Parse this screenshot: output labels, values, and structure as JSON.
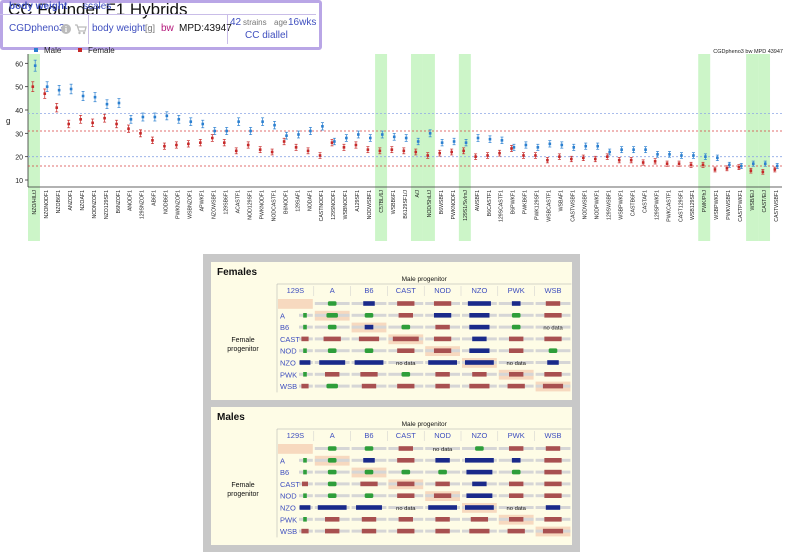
{
  "page_title": "CC Founder F1 Hybrids",
  "info": {
    "measure_label": "body weight",
    "scales_label": "scales",
    "dataset": "CGDpheno3",
    "info_icon": "info-icon",
    "cart_icon": "cart-icon",
    "measure_name": "body weight",
    "units": "[g]",
    "abbrev": "bw",
    "mpd_id": "MPD:43947",
    "strains_count": "42",
    "strains_label": "strains",
    "age_label": "age",
    "age_value": "16wks",
    "panel_name": "CC diallel"
  },
  "chart_data": {
    "type": "scatter",
    "title": "",
    "corner_label": "CGDpheno3 bw MPD 43947",
    "ylabel": "g",
    "ylim": [
      7,
      64
    ],
    "yticks": [
      10,
      20,
      30,
      40,
      50,
      60
    ],
    "legend": [
      {
        "name": "Male",
        "color": "#2a7fd0"
      },
      {
        "name": "Female",
        "color": "#c62828"
      }
    ],
    "legend_position": "top-left",
    "ref_lines": {
      "male": [
        38.5,
        20
      ],
      "female": [
        31,
        16
      ]
    },
    "highlighted": [
      "NZO/HILtJ",
      "C57BL/6J",
      "A/J",
      "NOD/ShiLtJ",
      "129S1/SvImJ",
      "PWK/PhJ",
      "WSB/EiJ",
      "CAST/EiJ"
    ],
    "strains": [
      {
        "name": "NZO/HILtJ",
        "male": 59,
        "female": 50
      },
      {
        "name": "NZONODF1",
        "male": 50,
        "female": 47
      },
      {
        "name": "NZOB6F1",
        "male": 48.5,
        "female": 41
      },
      {
        "name": "ANZOF1",
        "male": 49,
        "female": 34
      },
      {
        "name": "NZOAF1",
        "male": 46,
        "female": 36
      },
      {
        "name": "NODNZOF1",
        "male": 45.5,
        "female": 34.5
      },
      {
        "name": "NZO129SF1",
        "male": 42.5,
        "female": 36.5
      },
      {
        "name": "B6NZOF1",
        "male": 43,
        "female": 34
      },
      {
        "name": "ANODF1",
        "male": 36,
        "female": 32
      },
      {
        "name": "129SNZOF1",
        "male": 37,
        "female": 30
      },
      {
        "name": "AB6F1",
        "male": 37,
        "female": 27
      },
      {
        "name": "NODB6F1",
        "male": 37.5,
        "female": 24.5
      },
      {
        "name": "PWKNZOF1",
        "male": 36,
        "female": 25
      },
      {
        "name": "WSBNZOF1",
        "male": 35,
        "female": 25.5
      },
      {
        "name": "APWKF1",
        "male": 34,
        "female": 26
      },
      {
        "name": "NZOWSBF1",
        "male": 31,
        "female": 28
      },
      {
        "name": "129SB6F1",
        "male": 31,
        "female": 26
      },
      {
        "name": "ACASTF1",
        "male": 35,
        "female": 22.5
      },
      {
        "name": "NOD129SF1",
        "male": 31,
        "female": 25
      },
      {
        "name": "PWKNODF1",
        "male": 35,
        "female": 23
      },
      {
        "name": "NODCASTF1",
        "male": 33.5,
        "female": 22
      },
      {
        "name": "B6NODF1",
        "male": 29,
        "female": 26.5
      },
      {
        "name": "129SAF1",
        "male": 29.5,
        "female": 24
      },
      {
        "name": "NODAF1",
        "male": 31,
        "female": 22.5
      },
      {
        "name": "CASTNODF1",
        "male": 33,
        "female": 20.5
      },
      {
        "name": "129SNODF1",
        "male": 26.5,
        "female": 26
      },
      {
        "name": "WSBNODF1",
        "male": 28,
        "female": 24
      },
      {
        "name": "A129SF1",
        "male": 29.5,
        "female": 25
      },
      {
        "name": "NODWSBF1",
        "male": 28,
        "female": 23
      },
      {
        "name": "C57BL/6J",
        "male": 29.5,
        "female": 22.5
      },
      {
        "name": "WSBB6F1",
        "male": 28.5,
        "female": 23
      },
      {
        "name": "B6129SF1/J",
        "male": 28,
        "female": 22.5
      },
      {
        "name": "A/J",
        "male": 26.5,
        "female": 22
      },
      {
        "name": "NOD/ShiLtJ",
        "male": 30,
        "female": 20.5
      },
      {
        "name": "B6WSBF1",
        "male": 26,
        "female": 21.5
      },
      {
        "name": "PWKNODF1",
        "male": 26.5,
        "female": 22
      },
      {
        "name": "129S1/SvImJ",
        "male": 26,
        "female": 22.5
      },
      {
        "name": "AWSBF1",
        "male": 28,
        "female": 20
      },
      {
        "name": "B6CASTF1",
        "male": 27.5,
        "female": 20.5
      },
      {
        "name": "129SCASTF1",
        "male": 27,
        "female": 21.5
      },
      {
        "name": "B6PWKF1",
        "male": 24,
        "female": 23.5
      },
      {
        "name": "PWKB6F1",
        "male": 25,
        "female": 20.5
      },
      {
        "name": "PWK129SF1",
        "male": 24,
        "female": 20.5
      },
      {
        "name": "WSBCASTF1",
        "male": 25.5,
        "female": 18.5
      },
      {
        "name": "WSBAF1",
        "male": 25,
        "female": 20
      },
      {
        "name": "CASTWSBF1",
        "male": 24,
        "female": 19
      },
      {
        "name": "NODWSBF1",
        "male": 24.5,
        "female": 19.5
      },
      {
        "name": "NODPWKF1",
        "male": 24.5,
        "female": 19
      },
      {
        "name": "129SWSBF1",
        "male": 22,
        "female": 20
      },
      {
        "name": "WSBPWKF1",
        "male": 23,
        "female": 18.5
      },
      {
        "name": "CASTB6F1",
        "male": 23,
        "female": 18.5
      },
      {
        "name": "CASTAF1",
        "male": 23,
        "female": 17.5
      },
      {
        "name": "129SPWKF1",
        "male": 21,
        "female": 18
      },
      {
        "name": "PWKCASTF1",
        "male": 21,
        "female": 17
      },
      {
        "name": "CAST129SF1",
        "male": 20.5,
        "female": 17
      },
      {
        "name": "WSB129SF1",
        "male": 20.5,
        "female": 16.5
      },
      {
        "name": "PWK/PhJ",
        "male": 20,
        "female": 16.5
      },
      {
        "name": "WSBPWKF1",
        "male": 19.5,
        "female": 14.5
      },
      {
        "name": "PWKWSBF1",
        "male": 16.5,
        "female": 15
      },
      {
        "name": "CASTPWKF1",
        "male": 16,
        "female": 15.5
      },
      {
        "name": "WSB/EiJ",
        "male": 17,
        "female": 14
      },
      {
        "name": "CAST/EiJ",
        "male": 17,
        "female": 13.5
      },
      {
        "name": "CASTWSBF1",
        "male": 16,
        "female": 14.5
      }
    ]
  },
  "progenitors": [
    "129S",
    "A",
    "B6",
    "CAST",
    "NOD",
    "NZO",
    "PWK",
    "WSB"
  ],
  "panels": {
    "male_axis_label": "Male progenitor",
    "female_axis_label": "Female progenitor",
    "no_data_label": "no data",
    "females": {
      "title": "Females",
      "grid": [
        [
          [
            0,
            "g",
            0.5
          ],
          [
            0,
            "g",
            0.3
          ],
          [
            0,
            "b",
            0.4
          ],
          [
            0,
            "r",
            0.6
          ],
          [
            0,
            "r",
            0.6
          ],
          [
            0,
            "b",
            0.8
          ],
          [
            0,
            "b",
            0.3
          ],
          [
            0,
            "r",
            0.5
          ]
        ],
        [
          [
            0,
            "g",
            0.3
          ],
          [
            0,
            "g",
            0.4
          ],
          [
            0,
            "g",
            0.3
          ],
          [
            0,
            "r",
            0.5
          ],
          [
            0,
            "b",
            0.6
          ],
          [
            0,
            "b",
            0.7
          ],
          [
            0,
            "g",
            0.3
          ],
          [
            0,
            "r",
            0.6
          ]
        ],
        [
          [
            0,
            "g",
            0.3
          ],
          [
            0,
            "g",
            0.3
          ],
          [
            0,
            "b",
            0.3
          ],
          [
            0,
            "g",
            0.3
          ],
          [
            0,
            "r",
            0.5
          ],
          [
            0,
            "b",
            0.7
          ],
          [
            0,
            "g",
            0.3
          ],
          [
            1,
            "",
            0
          ]
        ],
        [
          [
            0,
            "r",
            0.6
          ],
          [
            0,
            "r",
            0.6
          ],
          [
            0,
            "r",
            0.7
          ],
          [
            0,
            "r",
            0.9
          ],
          [
            0,
            "r",
            0.6
          ],
          [
            0,
            "b",
            0.5
          ],
          [
            0,
            "r",
            0.5
          ],
          [
            0,
            "r",
            0.6
          ]
        ],
        [
          [
            0,
            "g",
            0.3
          ],
          [
            0,
            "g",
            0.3
          ],
          [
            0,
            "g",
            0.3
          ],
          [
            0,
            "r",
            0.6
          ],
          [
            0,
            "r",
            0.6
          ],
          [
            0,
            "b",
            0.7
          ],
          [
            0,
            "r",
            0.5
          ],
          [
            0,
            "g",
            0.3
          ]
        ],
        [
          [
            0,
            "b",
            0.9
          ],
          [
            0,
            "b",
            0.9
          ],
          [
            0,
            "b",
            1.0
          ],
          [
            1,
            "",
            0
          ],
          [
            0,
            "b",
            1.0
          ],
          [
            0,
            "b",
            1.0
          ],
          [
            1,
            "",
            0
          ],
          [
            0,
            "b",
            0.4
          ]
        ],
        [
          [
            0,
            "g",
            0.3
          ],
          [
            0,
            "r",
            0.5
          ],
          [
            0,
            "r",
            0.6
          ],
          [
            0,
            "g",
            0.3
          ],
          [
            0,
            "r",
            0.5
          ],
          [
            0,
            "r",
            0.5
          ],
          [
            0,
            "r",
            0.5
          ],
          [
            0,
            "r",
            0.6
          ]
        ],
        [
          [
            0,
            "r",
            0.6
          ],
          [
            0,
            "g",
            0.4
          ],
          [
            0,
            "r",
            0.5
          ],
          [
            0,
            "r",
            0.6
          ],
          [
            0,
            "r",
            0.5
          ],
          [
            0,
            "r",
            0.7
          ],
          [
            0,
            "r",
            0.6
          ],
          [
            0,
            "r",
            0.7
          ]
        ]
      ]
    },
    "males": {
      "title": "Males",
      "grid": [
        [
          [
            0,
            "g",
            0.3
          ],
          [
            0,
            "g",
            0.3
          ],
          [
            0,
            "g",
            0.3
          ],
          [
            0,
            "r",
            0.5
          ],
          [
            1,
            "",
            0
          ],
          [
            0,
            "g",
            0.3
          ],
          [
            0,
            "r",
            0.5
          ],
          [
            0,
            "r",
            0.5
          ]
        ],
        [
          [
            0,
            "g",
            0.3
          ],
          [
            0,
            "g",
            0.3
          ],
          [
            0,
            "b",
            0.4
          ],
          [
            0,
            "r",
            0.6
          ],
          [
            0,
            "b",
            0.5
          ],
          [
            0,
            "b",
            1.0
          ],
          [
            0,
            "b",
            0.3
          ],
          [
            0,
            "r",
            0.6
          ]
        ],
        [
          [
            0,
            "g",
            0.3
          ],
          [
            0,
            "g",
            0.3
          ],
          [
            0,
            "g",
            0.3
          ],
          [
            0,
            "g",
            0.3
          ],
          [
            0,
            "g",
            0.3
          ],
          [
            0,
            "b",
            0.9
          ],
          [
            0,
            "g",
            0.3
          ],
          [
            0,
            "r",
            0.6
          ]
        ],
        [
          [
            0,
            "r",
            0.5
          ],
          [
            0,
            "g",
            0.3
          ],
          [
            0,
            "r",
            0.6
          ],
          [
            0,
            "r",
            0.6
          ],
          [
            0,
            "r",
            0.5
          ],
          [
            0,
            "b",
            0.5
          ],
          [
            0,
            "r",
            0.5
          ],
          [
            0,
            "r",
            0.6
          ]
        ],
        [
          [
            0,
            "g",
            0.3
          ],
          [
            0,
            "g",
            0.3
          ],
          [
            0,
            "g",
            0.3
          ],
          [
            0,
            "r",
            0.6
          ],
          [
            0,
            "r",
            0.6
          ],
          [
            0,
            "b",
            0.9
          ],
          [
            0,
            "r",
            0.5
          ],
          [
            0,
            "r",
            0.6
          ]
        ],
        [
          [
            0,
            "b",
            0.9
          ],
          [
            0,
            "b",
            1.0
          ],
          [
            0,
            "b",
            0.9
          ],
          [
            1,
            "",
            0
          ],
          [
            0,
            "b",
            1.0
          ],
          [
            0,
            "b",
            1.0
          ],
          [
            1,
            "",
            0
          ],
          [
            0,
            "b",
            0.5
          ]
        ],
        [
          [
            0,
            "g",
            0.3
          ],
          [
            0,
            "r",
            0.5
          ],
          [
            0,
            "r",
            0.5
          ],
          [
            0,
            "r",
            0.5
          ],
          [
            0,
            "r",
            0.5
          ],
          [
            0,
            "r",
            0.6
          ],
          [
            0,
            "r",
            0.5
          ],
          [
            0,
            "r",
            0.6
          ]
        ],
        [
          [
            0,
            "r",
            0.6
          ],
          [
            0,
            "r",
            0.5
          ],
          [
            0,
            "r",
            0.5
          ],
          [
            0,
            "r",
            0.6
          ],
          [
            0,
            "r",
            0.5
          ],
          [
            0,
            "r",
            0.7
          ],
          [
            0,
            "r",
            0.6
          ],
          [
            0,
            "r",
            0.7
          ]
        ]
      ]
    }
  },
  "colors": {
    "male": "#2a7fd0",
    "female": "#c62828",
    "highlight": "#ccf5c8",
    "ref_male": "#8ea8e6",
    "ref_female": "#d84040",
    "dash_green": "#2e9e3a",
    "dash_blue": "#1a2a8a",
    "dash_red": "#a85050",
    "diag": "#f7d9bf",
    "panel_link": "#3f4fbf"
  }
}
